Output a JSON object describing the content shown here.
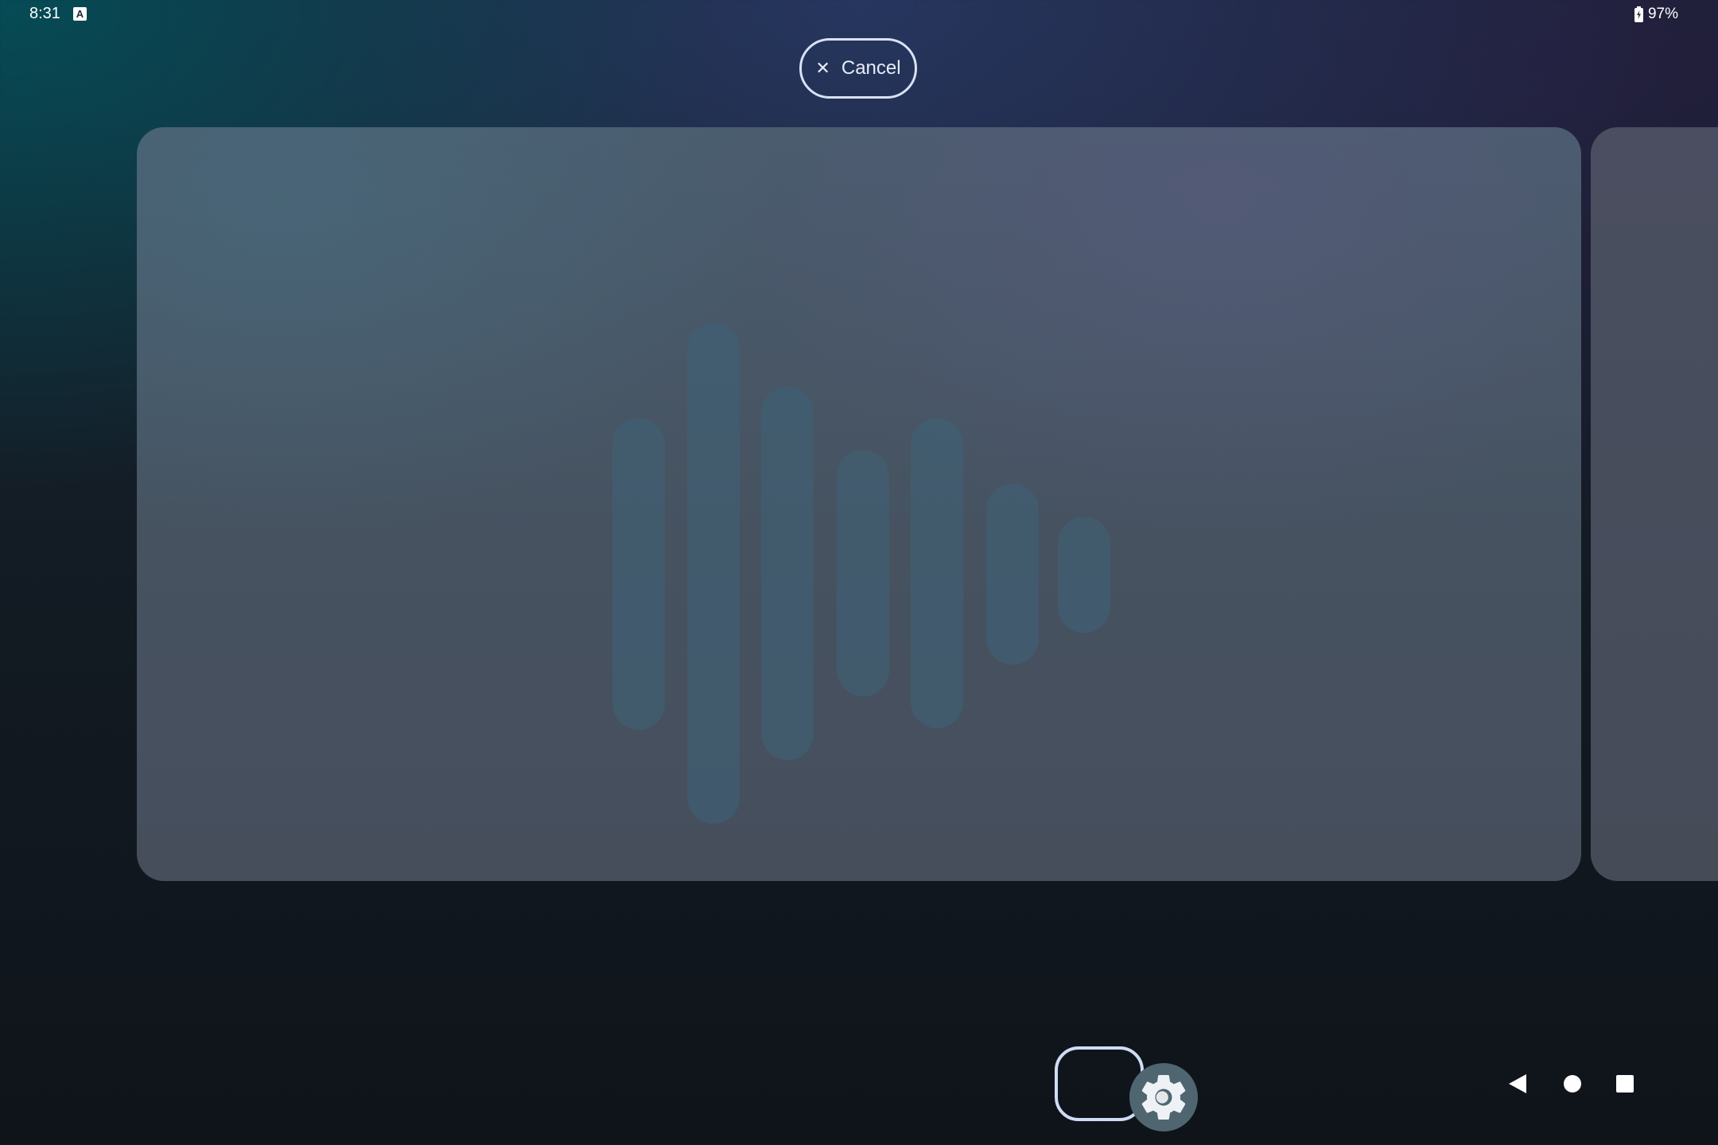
{
  "status_bar": {
    "time": "8:31",
    "notification_icon": "A",
    "battery_percent": "97%",
    "battery_icon": "battery-charging-icon"
  },
  "cancel_button": {
    "label": "Cancel",
    "icon": "close-icon"
  },
  "recents": {
    "card_icon": "audio-waveform-icon"
  },
  "taskbar": {
    "app_icon": "settings-gear-icon"
  },
  "nav_bar": {
    "back_icon": "back-triangle-icon",
    "home_icon": "home-circle-icon",
    "recents_icon": "recents-square-icon"
  },
  "colors": {
    "outline": "#d8e2f4",
    "card": "#4a5c6e",
    "waveform": "#3e6278"
  }
}
